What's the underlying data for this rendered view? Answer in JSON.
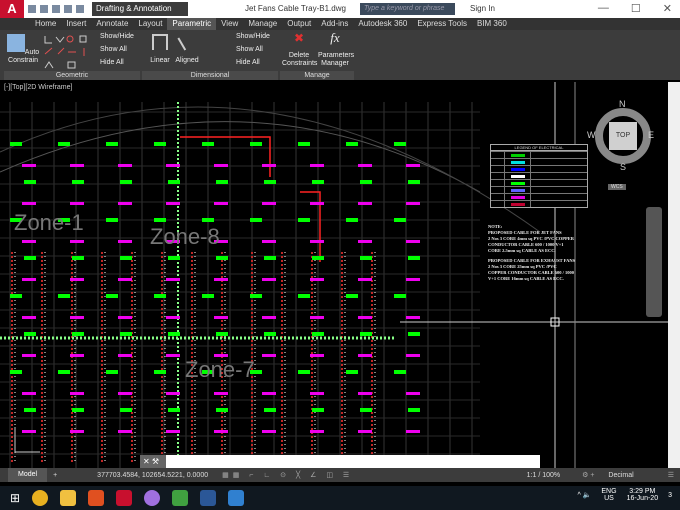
{
  "titlebar": {
    "logo": "A",
    "workspace": "Drafting & Annotation",
    "document_title": "Jet Fans Cable Tray-B1.dwg",
    "search_placeholder": "Type a keyword or phrase",
    "sign_in": "Sign In",
    "minimize": "—",
    "maximize": "☐",
    "close": "✕"
  },
  "tabs": [
    "Home",
    "Insert",
    "Annotate",
    "Layout",
    "Parametric",
    "View",
    "Manage",
    "Output",
    "Add-ins",
    "Autodesk 360",
    "Express Tools",
    "BIM 360"
  ],
  "active_tab": "Parametric",
  "ribbon": {
    "auto_constrain": "Auto Constrain",
    "show_hide": "Show/Hide",
    "show_all": "Show All",
    "hide_all": "Hide All",
    "linear": "Linear",
    "aligned": "Aligned",
    "show_hide2": "Show/Hide",
    "show_all2": "Show All",
    "hide_all2": "Hide All",
    "delete_constraints": "Delete Constraints",
    "parameters_manager": "Parameters Manager",
    "panels": [
      "Geometric",
      "Dimensional",
      "Manage"
    ]
  },
  "viewport": {
    "label": "[-][Top][2D Wireframe]",
    "zones": [
      "Zone-1",
      "Zone-8",
      "Zone-7"
    ],
    "compass": {
      "n": "N",
      "s": "S",
      "e": "E",
      "w": "W",
      "top": "TOP",
      "wcs": "WCS"
    },
    "legend_title": "LEGEND OF ELECTRICAL",
    "legend_colors": [
      "#00d000",
      "#00e0e0",
      "#0000ff",
      "#ffffff",
      "#00ff00",
      "#6060ff",
      "#e000e0",
      "#c00030"
    ],
    "notes": [
      "NOTE:",
      "PROPOSED CABLE FOR JET FANS",
      "2 Nos 3 CORE 4mm sq PVC /PVC COPPER",
      "CONDUCTOR CABLE 600 / 1000 V+1",
      "CORE 2.5mm sq CABLE AS ECC.",
      "PROPOSED CABLE FOR EXHAUST FANS",
      "2 Nos 3 CORE 25mm sq PVC /PVC",
      "COPPER CONDUCTOR CABLE 600 / 1000",
      "V+1 CORE 16mm sq CABLE AS ECC."
    ]
  },
  "command_line": {
    "value": ""
  },
  "status": {
    "model_tab": "Model",
    "coordinates": "377703.4584, 102654.5221, 0.0000",
    "scale": "1:1 / 100%",
    "units": "Decimal"
  },
  "taskbar": {
    "lang": "ENG",
    "region": "US",
    "time": "3:29 PM",
    "date": "16-Jun-20",
    "notifications": "3"
  }
}
